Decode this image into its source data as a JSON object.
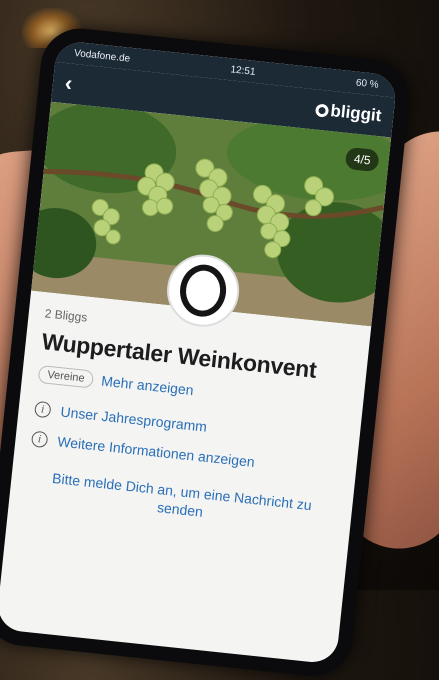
{
  "status": {
    "carrier": "Vodafone.de",
    "time": "12:51",
    "battery": "60 %"
  },
  "nav": {
    "back_icon": "‹",
    "logo_text": "bliggit"
  },
  "hero": {
    "counter": "4/5"
  },
  "club": {
    "count": "2 Bliggs",
    "title": "Wuppertaler Weinkonvent",
    "tag": "Vereine",
    "more_link": "Mehr anzeigen"
  },
  "info": {
    "program_link": "Unser Jahresprogramm",
    "more_info_link": "Weitere Informationen anzeigen",
    "icon_glyph": "i"
  },
  "login_prompt": "Bitte melde Dich an, um eine Nachricht zu senden",
  "colors": {
    "navbar": "#1c2a36",
    "link": "#2a6fb8"
  }
}
